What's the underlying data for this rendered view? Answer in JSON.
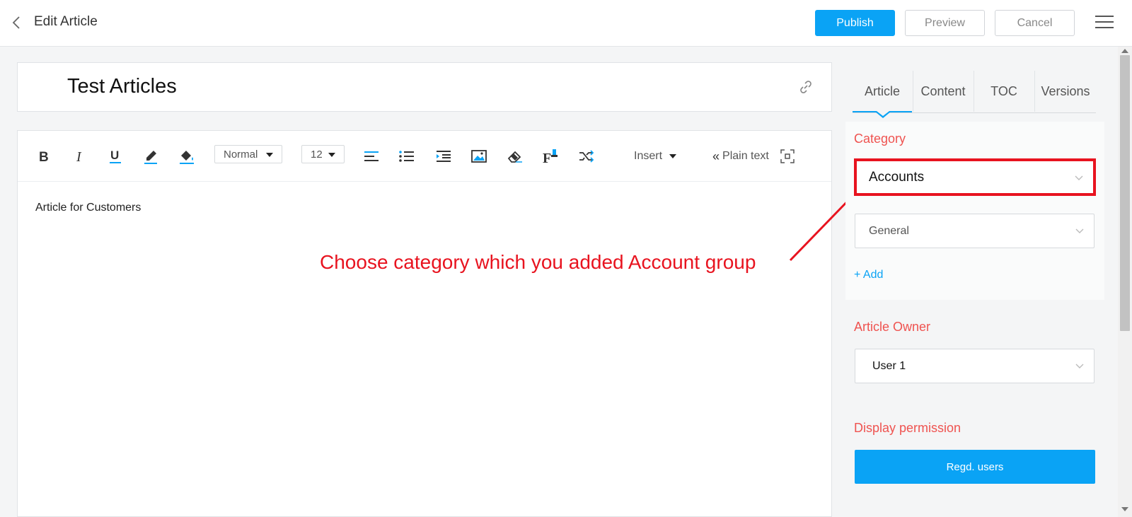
{
  "header": {
    "title": "Edit Article",
    "publish_label": "Publish",
    "preview_label": "Preview",
    "cancel_label": "Cancel"
  },
  "article": {
    "title": "Test Articles",
    "body": "Article for Customers"
  },
  "toolbar": {
    "format_select": "Normal",
    "size_select": "12",
    "insert_label": "Insert",
    "plain_text_label": "Plain text"
  },
  "annotation": {
    "text": "Choose category which you added Account group",
    "color": "#e8131f"
  },
  "sidebar": {
    "tabs": [
      {
        "label": "Article"
      },
      {
        "label": "Content"
      },
      {
        "label": "TOC"
      },
      {
        "label": "Versions"
      }
    ],
    "category_label": "Category",
    "category_value": "Accounts",
    "subcategory_value": "General",
    "add_label": "+ Add",
    "owner_label": "Article Owner",
    "owner_value": "User 1",
    "permission_label": "Display permission",
    "permission_value": "Regd. users"
  },
  "colors": {
    "accent": "#0aa3f5",
    "label": "#ef5350"
  }
}
